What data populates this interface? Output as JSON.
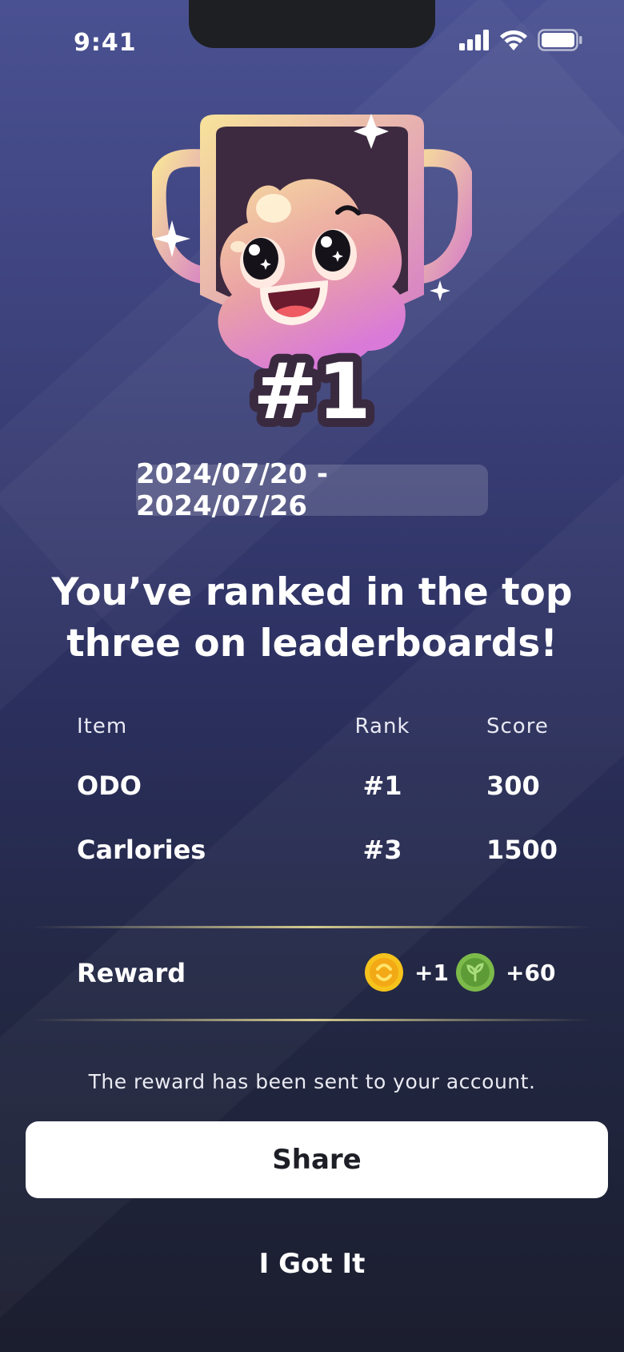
{
  "status_bar": {
    "time": "9:41",
    "icons": [
      "cellular-signal-icon",
      "wifi-icon",
      "battery-icon"
    ]
  },
  "hero": {
    "rank_text": "#1",
    "mascot": "trophy-mascot-illustration"
  },
  "date_range": "2024/07/20 - 2024/07/26",
  "headline": "You’ve ranked in the top three on leaderboards!",
  "table": {
    "headers": [
      "Item",
      "Rank",
      "Score"
    ],
    "rows": [
      {
        "item": "ODO",
        "rank": "#1",
        "score": "300"
      },
      {
        "item": "Carlories",
        "rank": "#3",
        "score": "1500"
      }
    ]
  },
  "reward": {
    "label": "Reward",
    "items": [
      {
        "icon": "gold-coin-icon",
        "amount": "+1"
      },
      {
        "icon": "green-coin-icon",
        "amount": "+60"
      }
    ]
  },
  "notice": "The reward has been sent to your account.",
  "buttons": {
    "share": "Share",
    "got_it": "I Got It"
  },
  "colors": {
    "background_top": "#4a5192",
    "background_bottom": "#1b1e2e",
    "gold": "#f6c21c",
    "green": "#7cba4a"
  }
}
